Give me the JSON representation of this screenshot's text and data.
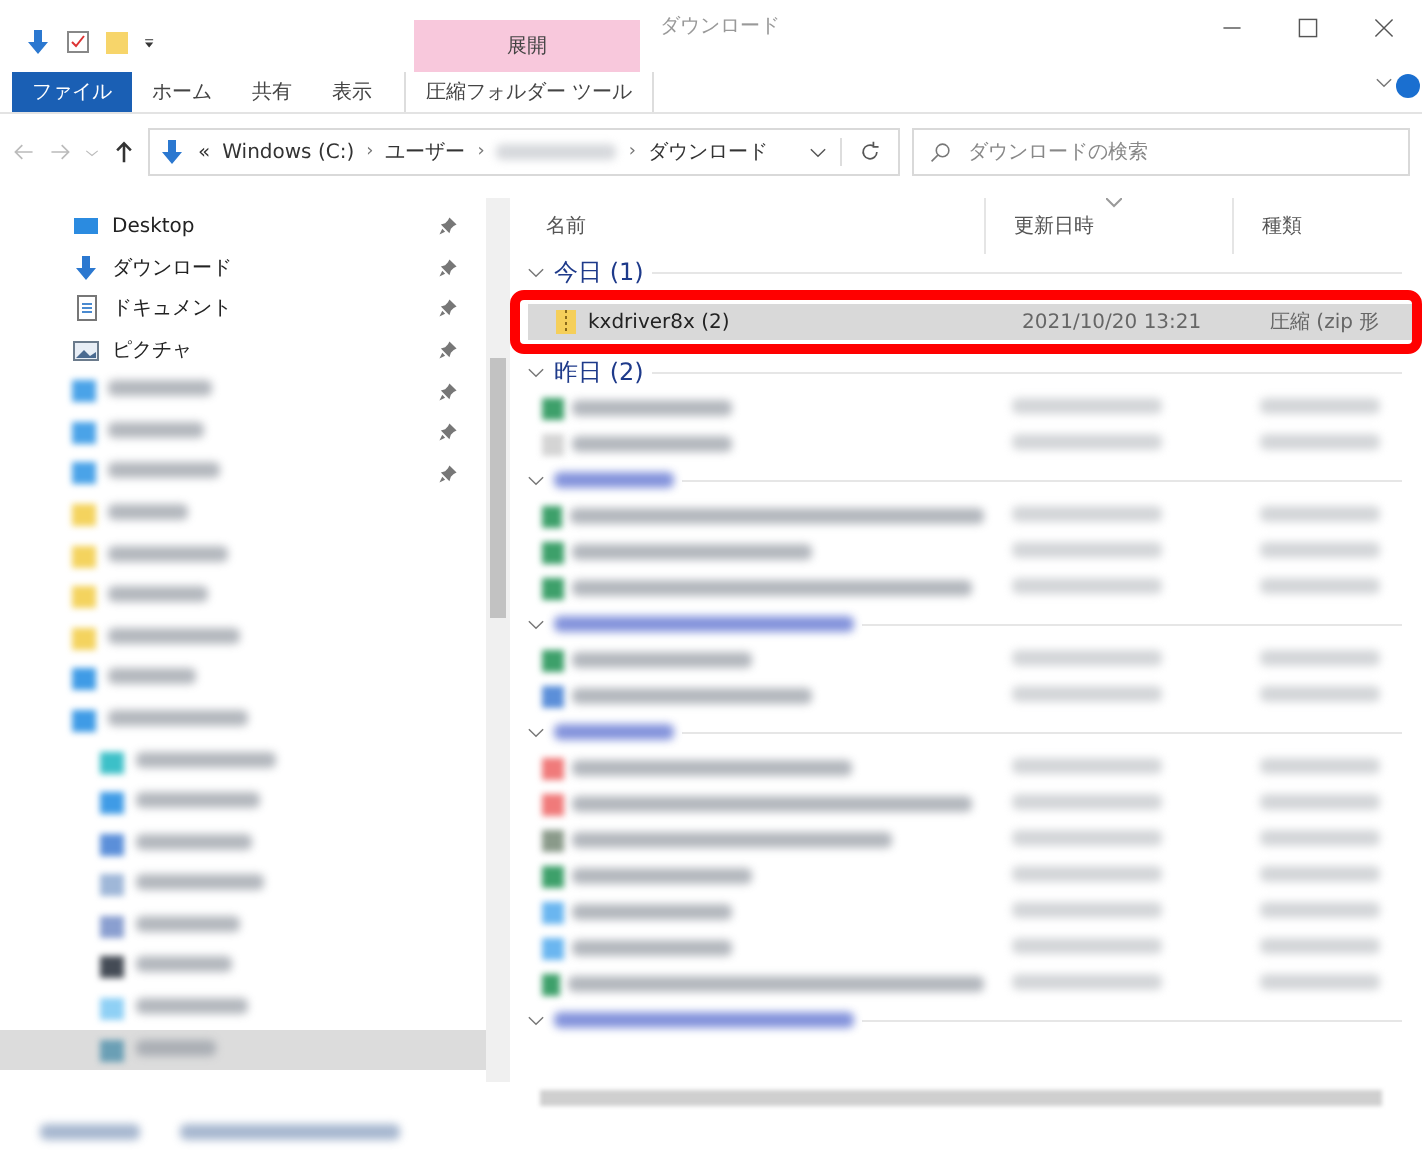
{
  "title_bar": {
    "context_group": "展開",
    "window_title": "ダウンロード"
  },
  "ribbon_tabs": [
    {
      "label": "ファイル",
      "kind": "file"
    },
    {
      "label": "ホーム",
      "kind": "plain"
    },
    {
      "label": "共有",
      "kind": "plain"
    },
    {
      "label": "表示",
      "kind": "plain"
    },
    {
      "label": "圧縮フォルダー ツール",
      "kind": "context"
    }
  ],
  "address": {
    "overflow": "«",
    "segments": [
      {
        "kind": "text",
        "label": "Windows (C:)"
      },
      {
        "kind": "text",
        "label": "ユーザー",
        "separator": "›"
      },
      {
        "kind": "blurred",
        "separator": "›"
      },
      {
        "kind": "text",
        "label": "ダウンロード",
        "separator": "›"
      }
    ]
  },
  "search": {
    "placeholder": "ダウンロードの検索"
  },
  "sidebar": {
    "items": [
      {
        "kind": "desktop",
        "label": "Desktop",
        "pinned": true,
        "selected": false
      },
      {
        "kind": "download",
        "label": "ダウンロード",
        "pinned": true,
        "selected": false
      },
      {
        "kind": "document",
        "label": "ドキュメント",
        "pinned": true,
        "selected": false
      },
      {
        "kind": "picture",
        "label": "ピクチャ",
        "pinned": true,
        "selected": false
      },
      {
        "kind": "blurred",
        "color": "#4aa3e8",
        "pinned": true,
        "selected": false
      },
      {
        "kind": "blurred",
        "color": "#4aa3e8",
        "pinned": true,
        "selected": false
      },
      {
        "kind": "blurred",
        "color": "#4aa3e8",
        "pinned": true,
        "selected": false
      },
      {
        "kind": "blurred",
        "color": "#f4d35e",
        "pinned": false,
        "selected": false
      },
      {
        "kind": "blurred",
        "color": "#f4d35e",
        "pinned": false,
        "selected": false
      },
      {
        "kind": "blurred",
        "color": "#f4d35e",
        "pinned": false,
        "selected": false
      },
      {
        "kind": "blurred",
        "color": "#f4d35e",
        "pinned": false,
        "selected": false
      },
      {
        "kind": "blurred",
        "color": "#3f9be6",
        "pinned": false,
        "selected": false
      },
      {
        "kind": "blurred",
        "color": "#3f9be6",
        "pinned": false,
        "selected": false,
        "children": [
          {
            "kind": "blurred",
            "color": "#3cc0c8",
            "pinned": false,
            "selected": false
          },
          {
            "kind": "blurred",
            "color": "#3f9be6",
            "pinned": false,
            "selected": false
          },
          {
            "kind": "blurred",
            "color": "#5b8fd9",
            "pinned": false,
            "selected": false
          },
          {
            "kind": "blurred",
            "color": "#9fb7d8",
            "pinned": false,
            "selected": false
          },
          {
            "kind": "blurred",
            "color": "#8a9fd0",
            "pinned": false,
            "selected": false
          },
          {
            "kind": "blurred",
            "color": "#444b55",
            "pinned": false,
            "selected": false
          },
          {
            "kind": "blurred",
            "color": "#8fd0f5",
            "pinned": false,
            "selected": false
          },
          {
            "kind": "blurred",
            "color": "#6a9fb5",
            "pinned": false,
            "selected": true
          }
        ]
      }
    ]
  },
  "columns": [
    {
      "label": "名前",
      "sorted": false
    },
    {
      "label": "更新日時",
      "sorted": true
    },
    {
      "label": "種類",
      "sorted": false
    }
  ],
  "groups": [
    {
      "kind": "text",
      "label": "今日 (1)",
      "expanded": true,
      "rows": [
        {
          "kind": "file",
          "name": "kxdriver8x (2)",
          "modified": "2021/10/20 13:21",
          "type": "圧縮 (zip 形",
          "selected": true,
          "highlighted": true
        }
      ]
    },
    {
      "kind": "text",
      "label": "昨日 (2)",
      "expanded": true,
      "rows": [
        {
          "kind": "blurred",
          "color": "#3da06a",
          "selected": false,
          "highlighted": false
        },
        {
          "kind": "blurred",
          "color": "#d4d4d4",
          "selected": false,
          "highlighted": false
        }
      ]
    },
    {
      "kind": "blurred",
      "expanded": true,
      "rows": [
        {
          "kind": "blurred",
          "color": "#3da06a",
          "selected": false,
          "highlighted": false
        },
        {
          "kind": "blurred",
          "color": "#3da06a",
          "selected": false,
          "highlighted": false
        },
        {
          "kind": "blurred",
          "color": "#3da06a",
          "selected": false,
          "highlighted": false
        }
      ]
    },
    {
      "kind": "blurred",
      "expanded": true,
      "rows": [
        {
          "kind": "blurred",
          "color": "#3da06a",
          "selected": false,
          "highlighted": false
        },
        {
          "kind": "blurred",
          "color": "#5b8fd9",
          "selected": false,
          "highlighted": false
        }
      ]
    },
    {
      "kind": "blurred",
      "expanded": true,
      "rows": [
        {
          "kind": "blurred",
          "color": "#f07a7a",
          "selected": false,
          "highlighted": false
        },
        {
          "kind": "blurred",
          "color": "#f07a7a",
          "selected": false,
          "highlighted": false
        },
        {
          "kind": "blurred",
          "color": "#8a9a8a",
          "selected": false,
          "highlighted": false
        },
        {
          "kind": "blurred",
          "color": "#3da06a",
          "selected": false,
          "highlighted": false
        },
        {
          "kind": "blurred",
          "color": "#6ab6f0",
          "selected": false,
          "highlighted": false
        },
        {
          "kind": "blurred",
          "color": "#6ab6f0",
          "selected": false,
          "highlighted": false
        },
        {
          "kind": "blurred",
          "color": "#3da06a",
          "selected": false,
          "highlighted": false
        }
      ]
    },
    {
      "kind": "blurred",
      "expanded": true
    }
  ]
}
